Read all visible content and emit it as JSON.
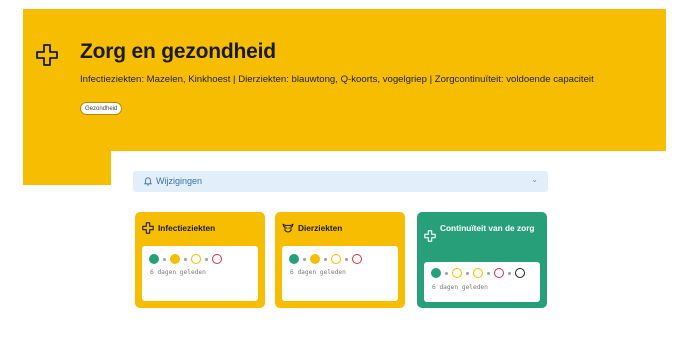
{
  "hero": {
    "title": "Zorg en gezondheid",
    "subtitle": "Infectieziekten: Mazelen, Kinkhoest | Dierziekten: blauwtong, Q-koorts, vogelgriep | Zorgcontinuïteit: voldoende capaciteit",
    "tag": "Gezondheid",
    "icon": "medical-cross-icon"
  },
  "changes": {
    "label": "Wijzigingen",
    "icon": "bell-icon",
    "chevron": "chevron-down-icon",
    "chevron_glyph": "⌄"
  },
  "cards": [
    {
      "title": "Infectieziekten",
      "icon": "medical-cross-icon",
      "color": "#f7bd00",
      "indicators": [
        "green-filled",
        "yellow-filled",
        "yellow-ring",
        "red-ring"
      ],
      "updated": "6 dagen geleden"
    },
    {
      "title": "Dierziekten",
      "icon": "cow-icon",
      "color": "#f7bd00",
      "indicators": [
        "green-filled",
        "yellow-filled",
        "yellow-ring",
        "red-ring"
      ],
      "updated": "6 dagen geleden"
    },
    {
      "title": "Continuïteit van de zorg",
      "icon": "medical-cross-icon",
      "color": "#27a07a",
      "indicators": [
        "green-filled",
        "yellow-ring",
        "yellow-ring",
        "red-ring",
        "black-ring"
      ],
      "updated": "6 dagen geleden"
    }
  ],
  "colors": {
    "brand_yellow": "#f7bd00",
    "status_green": "#27a07a",
    "status_red": "#d6334b",
    "changes_bg": "#e2effa"
  }
}
